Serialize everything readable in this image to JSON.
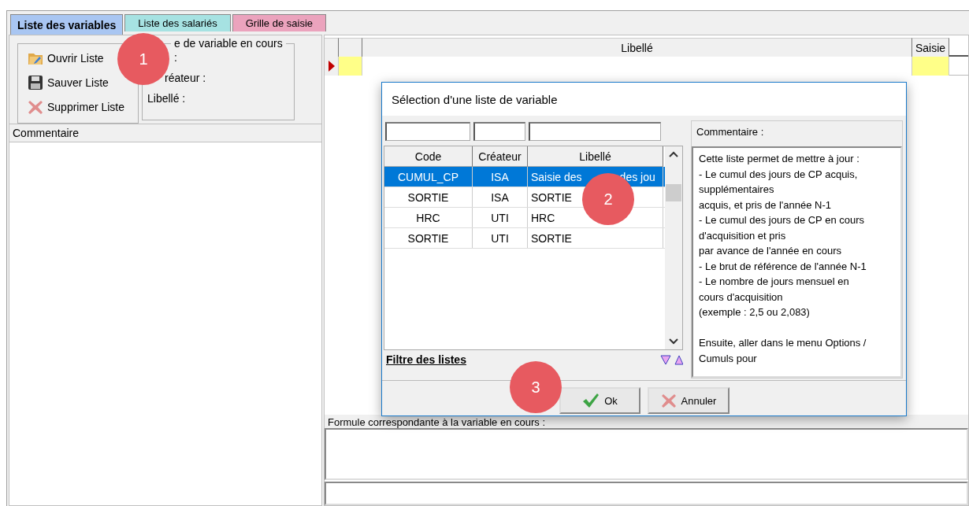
{
  "tabs": [
    {
      "label": "Liste des variables",
      "selected": true,
      "color": "#a9c6f2"
    },
    {
      "label": "Liste des salariés",
      "selected": false,
      "color": "#a6e2e2"
    },
    {
      "label": "Grille de saisie",
      "selected": false,
      "color": "#eba3bd"
    }
  ],
  "toolbar": [
    {
      "label": "Ouvrir Liste"
    },
    {
      "label": "Sauver Liste"
    },
    {
      "label": "Supprimer Liste"
    }
  ],
  "current_group": {
    "legend": "e de variable en cours",
    "fields": [
      {
        "label": ":"
      },
      {
        "label": "réateur :"
      },
      {
        "label": "Libellé :"
      }
    ]
  },
  "comment_header": "Commentaire",
  "grid": {
    "columns": [
      "Libellé",
      "Saisie"
    ],
    "current_row": true
  },
  "formula": {
    "label": "Formule correspondante à la variable en cours :"
  },
  "dialog": {
    "title": "Sélection d'une liste de variable",
    "columns": [
      "Code",
      "Créateur",
      "Libellé"
    ],
    "rows": [
      {
        "code": "CUMUL_CP",
        "createur": "ISA",
        "libelle": "Saisie des",
        "libelle_end": "des jou",
        "selected": true
      },
      {
        "code": "SORTIE",
        "createur": "ISA",
        "libelle": "SORTIE",
        "selected": false
      },
      {
        "code": "HRC",
        "createur": "UTI",
        "libelle": "HRC",
        "selected": false
      },
      {
        "code": "SORTIE",
        "createur": "UTI",
        "libelle": "SORTIE",
        "selected": false
      }
    ],
    "filter_link": "Filtre des listes",
    "comment_label": "Commentaire :",
    "comment_paragraphs": [
      [
        "Cette liste permet de mettre à jour :",
        "- Le cumul des jours de CP acquis,",
        "supplémentaires",
        "acquis, et pris de l'année N-1",
        "- Le cumul des jours de CP en cours",
        "d'acquisition et pris",
        "par avance de l'année en cours",
        "- Le brut de référence de l'année N-1",
        "- Le nombre de jours mensuel en",
        "cours d'acquisition",
        "(exemple : 2,5 ou 2,083)"
      ],
      [
        "Ensuite, aller dans le menu Options /",
        "Cumuls pour"
      ]
    ],
    "buttons": [
      {
        "label": "Ok"
      },
      {
        "label": "Annuler"
      }
    ]
  },
  "callouts": [
    "1",
    "2",
    "3"
  ]
}
